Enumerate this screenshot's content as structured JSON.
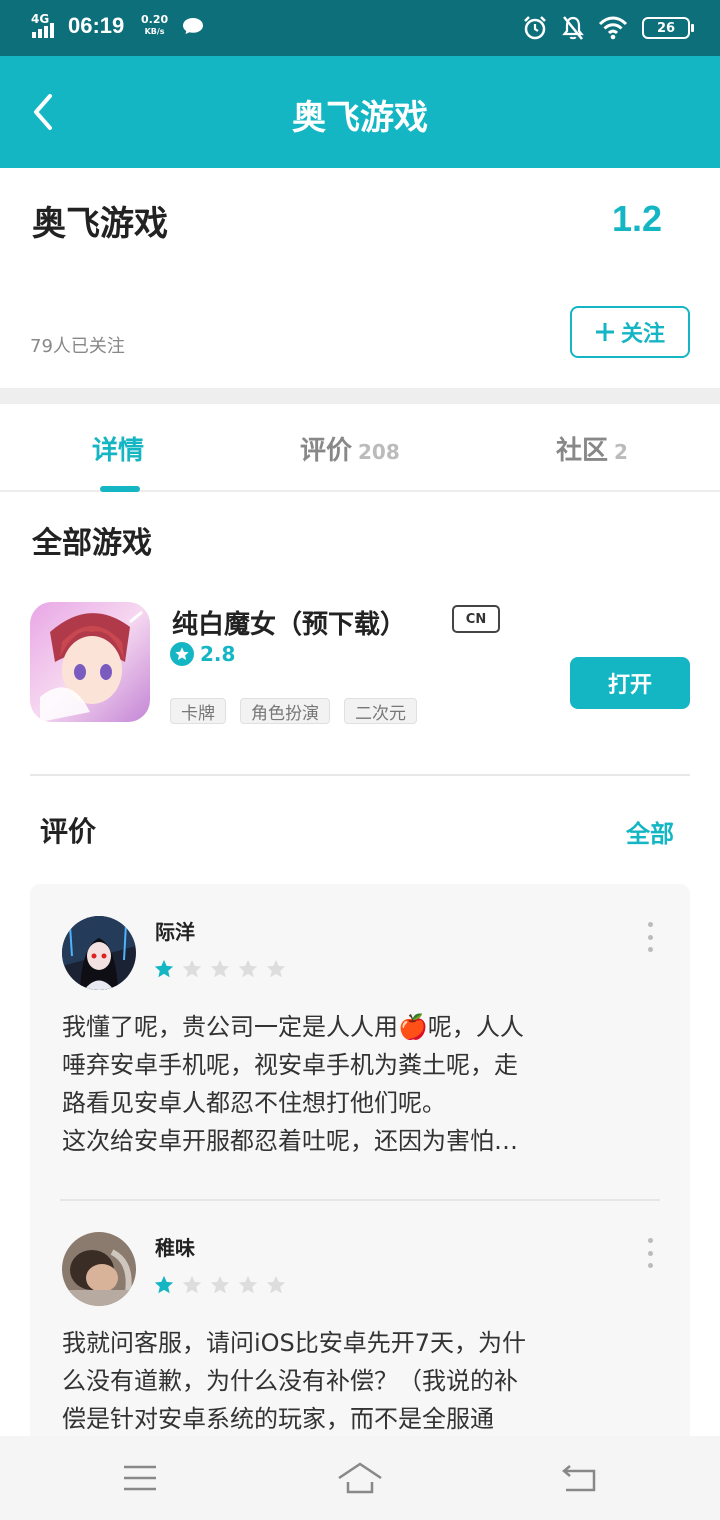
{
  "status_bar": {
    "network": "4G",
    "time": "06:19",
    "speed_value": "0.20",
    "speed_unit": "KB/s",
    "battery": "26"
  },
  "appbar": {
    "title": "奥飞游戏"
  },
  "developer": {
    "name": "奥飞游戏",
    "score": "1.2",
    "followers": "79人已关注",
    "follow_label": "关注"
  },
  "tabs": [
    {
      "label": "详情",
      "count": ""
    },
    {
      "label": "评价",
      "count": "208"
    },
    {
      "label": "社区",
      "count": "2"
    }
  ],
  "games_section": {
    "title": "全部游戏",
    "game": {
      "title": "纯白魔女（预下载）",
      "region_badge": "CN",
      "rating": "2.8",
      "tags": [
        "卡牌",
        "角色扮演",
        "二次元"
      ],
      "open_label": "打开"
    }
  },
  "reviews_section": {
    "title": "评价",
    "all_label": "全部",
    "reviews": [
      {
        "user": "际洋",
        "stars": 1,
        "text_lines": [
          "我懂了呢，贵公司一定是人人用🍎呢，人人",
          "唾弃安卓手机呢，视安卓手机为粪土呢，走",
          "路看见安卓人都忍不住想打他们呢。",
          "这次给安卓开服都忍着吐呢，还因为害怕…"
        ]
      },
      {
        "user": "稚味",
        "stars": 1,
        "text_lines": [
          "我就问客服，请问iOS比安卓先开7天，为什",
          "么没有道歉，为什么没有补偿？（我说的补",
          "偿是针对安卓系统的玩家，而不是全服通"
        ]
      }
    ]
  },
  "colors": {
    "status_bar": "#0d6f7a",
    "accent": "#15b6c4",
    "star_empty": "#dddddd"
  }
}
